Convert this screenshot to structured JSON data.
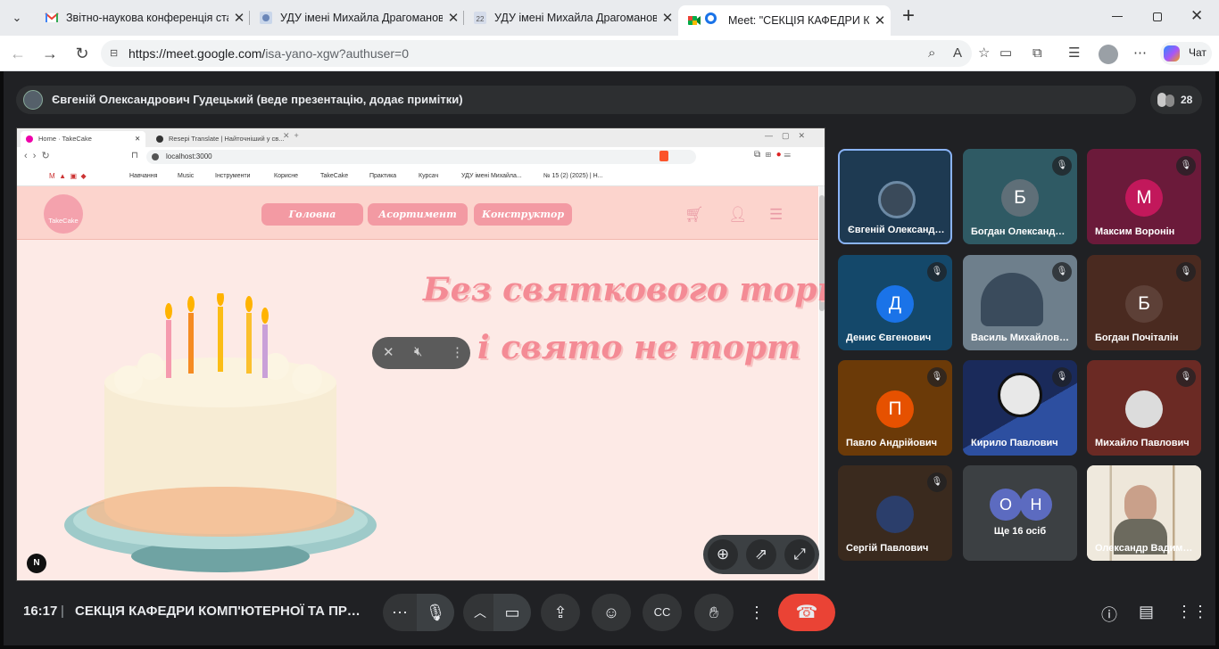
{
  "browser": {
    "tabs": [
      {
        "title": "Звітно-наукова конференція стар",
        "close": "✕"
      },
      {
        "title": "УДУ імені Михайла Драгоманова",
        "close": "✕"
      },
      {
        "title": "УДУ імені Михайла Драгоманова",
        "close": "✕"
      },
      {
        "title": "Meet: \"СЕКЦІЯ КАФЕДРИ КОМ",
        "close": "✕"
      }
    ],
    "new_tab": "+",
    "url_host": "https://meet.google.com/",
    "url_path": "isa-yano-xgw?authuser=0",
    "copilot_label": "Чат"
  },
  "meet": {
    "presenter_text": "Євгеній Олександрович Гудецький (веде презентацію, додає примітки)",
    "participant_count": "28",
    "time": "16:17",
    "separator": "|",
    "meeting_title": "СЕКЦІЯ КАФЕДРИ КОМП'ЮТЕРНОЇ ТА ПРОГРАМНОЇ ІНЖЕНЕРІЇ"
  },
  "shared": {
    "tabs": [
      "Home · TakeCake",
      "Resepi Translate | Найточніший у св..."
    ],
    "url": "localhost:3000",
    "bookmarks": [
      "Навчання",
      "Music",
      "Інструменти",
      "Корисне",
      "TakeCake",
      "Практика",
      "Курсач",
      "УДУ імені Михайла...",
      "№ 15 (2) (2025) | Н..."
    ],
    "logo": "TakeCake",
    "nav": [
      "Головна",
      "Асортимент",
      "Конструктор"
    ],
    "hero_line1": "Без святкового торту",
    "hero_line2": "і свято не торт",
    "n_badge": "N"
  },
  "tiles": [
    {
      "name": "Євгеній Олександрович Гудецький",
      "initial": "",
      "color": "#1e3a52",
      "muted": false,
      "active": true
    },
    {
      "name": "Богдан Олександрович",
      "initial": "Б",
      "color": "#5f6f78",
      "muted": true
    },
    {
      "name": "Максим Воронін",
      "initial": "М",
      "color": "#c2185b",
      "muted": true
    },
    {
      "name": "Денис Євгенович",
      "initial": "Д",
      "color": "#1a73e8",
      "muted": true
    },
    {
      "name": "Василь Михайлович",
      "initial": "",
      "color": "",
      "muted": true
    },
    {
      "name": "Богдан Почіталін",
      "initial": "Б",
      "color": "#5d4037",
      "muted": true
    },
    {
      "name": "Павло Андрійович",
      "initial": "П",
      "color": "#e65100",
      "muted": true
    },
    {
      "name": "Кирило Павлович",
      "initial": "",
      "color": "",
      "muted": true
    },
    {
      "name": "Михайло Павлович",
      "initial": "",
      "color": "",
      "muted": true
    },
    {
      "name": "Сергій Павлович",
      "initial": "",
      "color": "",
      "muted": true
    },
    {
      "name": "Ще 16 осіб",
      "initial": "",
      "color": "",
      "muted": false
    },
    {
      "name": "Олександр Вадимович",
      "initial": "",
      "color": "",
      "muted": false
    }
  ],
  "more_avatars": [
    "О",
    "Н"
  ],
  "colors": {
    "meet_bg": "#202124",
    "end_call": "#ea4335",
    "site_pink": "#f48b95"
  }
}
